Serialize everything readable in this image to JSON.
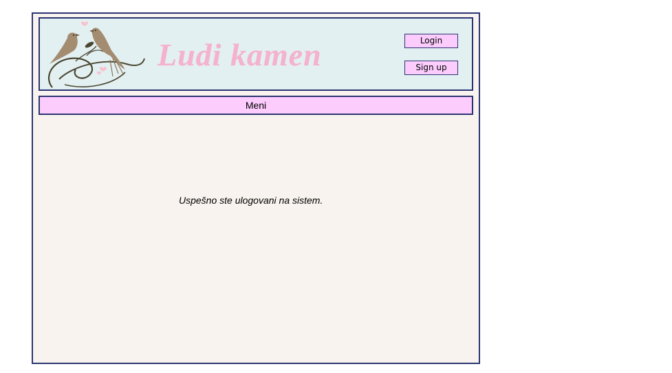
{
  "header": {
    "logo_icon": "love-birds-icon",
    "brand_title": "Ludi kamen",
    "brand_color": "#f4b2cf",
    "login_label": "Login",
    "signup_label": "Sign up"
  },
  "menu": {
    "label": "Meni"
  },
  "main": {
    "status_message": "Uspešno ste ulogovani na sistem."
  },
  "colors": {
    "border": "#2a3472",
    "header_background": "#e3f0f2",
    "button_background": "#fcccfd",
    "content_background": "#f8f3ee"
  }
}
